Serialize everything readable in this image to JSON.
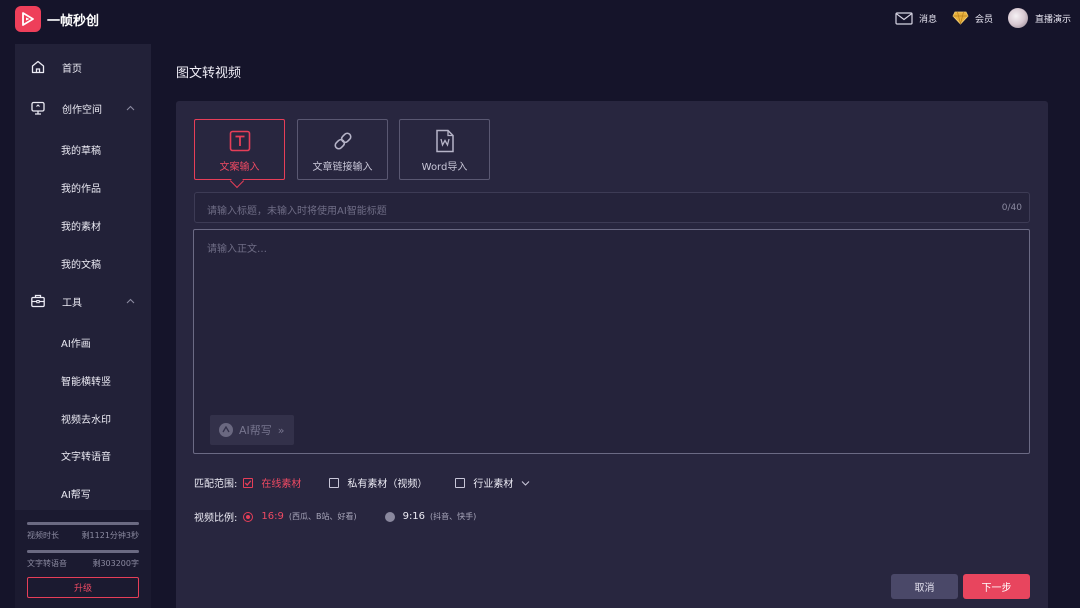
{
  "app": {
    "name": "一帧秒创"
  },
  "header": {
    "messages_label": "消息",
    "vip_label": "会员",
    "user_name": "直播演示"
  },
  "sidebar": {
    "home": "首页",
    "create_space": "创作空间",
    "create_items": [
      "我的草稿",
      "我的作品",
      "我的素材",
      "我的文稿"
    ],
    "tools": "工具",
    "tool_items": [
      "AI作画",
      "智能横转竖",
      "视频去水印",
      "文字转语音",
      "AI帮写"
    ],
    "quota": {
      "video_label": "视频时长",
      "video_value": "剩1121分钟3秒",
      "tts_label": "文字转语音",
      "tts_value": "剩303200字"
    },
    "upgrade": "升级"
  },
  "main": {
    "title": "图文转视频",
    "tabs": [
      {
        "label": "文案输入",
        "icon": "text-icon",
        "active": true
      },
      {
        "label": "文章链接输入",
        "icon": "link-icon",
        "active": false
      },
      {
        "label": "Word导入",
        "icon": "word-doc-icon",
        "active": false
      }
    ],
    "title_placeholder": "请输入标题，未输入时将使用AI智能标题",
    "title_counter": "0/40",
    "body_placeholder": "请输入正文…",
    "ai_write": "AI帮写",
    "match_label": "匹配范围:",
    "match_options": [
      {
        "label": "在线素材",
        "checked": true
      },
      {
        "label": "私有素材（视频）",
        "checked": false
      },
      {
        "label": "行业素材",
        "checked": false
      }
    ],
    "ratio_label": "视频比例:",
    "ratio_options": [
      {
        "label": "16:9",
        "note": "(西瓜、B站、好看)",
        "selected": true
      },
      {
        "label": "9:16",
        "note": "(抖音、快手)",
        "selected": false
      }
    ],
    "cancel": "取消",
    "next": "下一步"
  },
  "colors": {
    "accent": "#e8455e",
    "background": "#15142a",
    "panel": "#28263f",
    "sidebar": "#222138"
  }
}
